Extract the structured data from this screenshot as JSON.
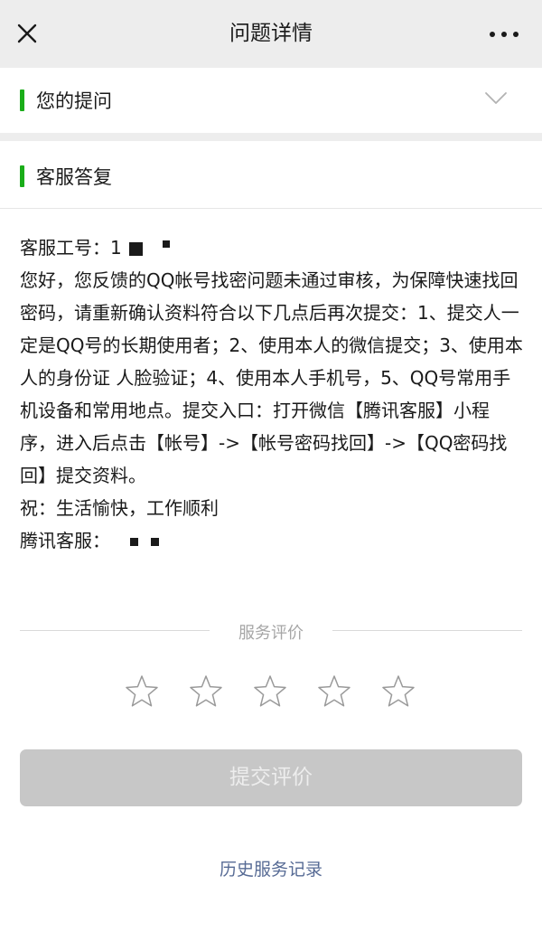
{
  "header": {
    "title": "问题详情"
  },
  "sections": {
    "question_label": "您的提问",
    "reply_label": "客服答复"
  },
  "reply": {
    "agent_id_label": "客服工号：1",
    "body": "您好，您反馈的QQ帐号找密问题未通过审核，为保障快速找回密码，请重新确认资料符合以下几点后再次提交：1、提交人一定是QQ号的长期使用者；2、使用本人的微信提交；3、使用本人的身份证 人脸验证；4、使用本人手机号，5、QQ号常用手机设备和常用地点。提交入口：打开微信【腾讯客服】小程序，进入后点击【帐号】->【帐号密码找回】->【QQ密码找回】提交资料。",
    "closing": "祝：生活愉快，工作顺利",
    "signature_label": "腾讯客服："
  },
  "rating": {
    "label": "服务评价",
    "stars": 5,
    "selected": 0
  },
  "submit": {
    "label": "提交评价"
  },
  "history": {
    "label": "历史服务记录"
  },
  "colors": {
    "accent_green": "#1aad19",
    "link_blue": "#576b95",
    "header_bg": "#ededed",
    "disabled_button": "#c7c7c7"
  },
  "icons": {
    "close": "close-icon",
    "more": "more-icon",
    "chevron": "chevron-down-icon",
    "star": "star-outline-icon"
  }
}
